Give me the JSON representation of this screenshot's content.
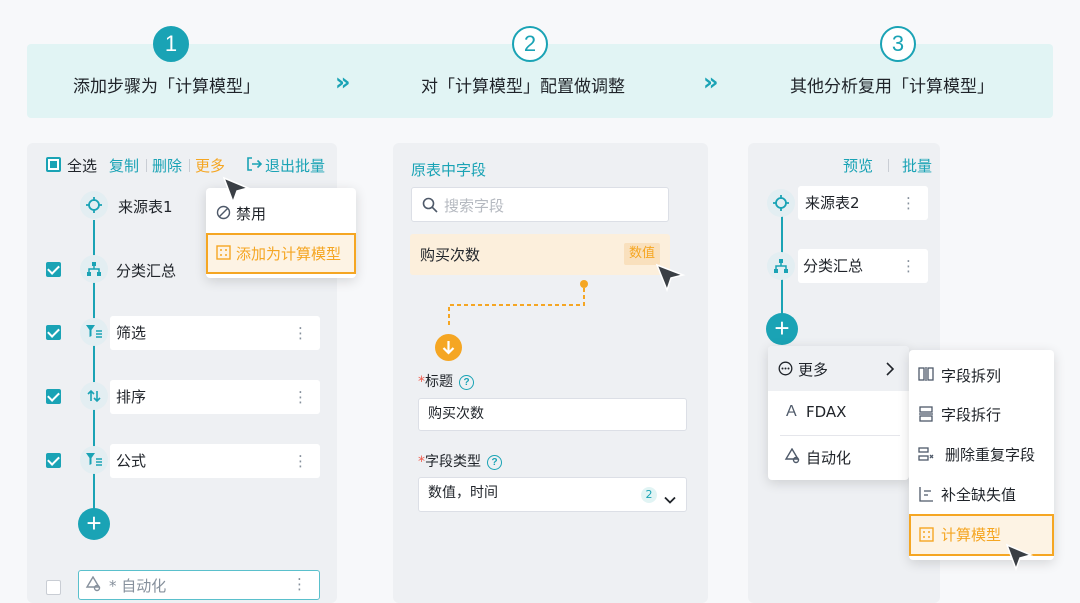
{
  "steps": [
    {
      "num": "1",
      "text": "添加步骤为「计算模型」"
    },
    {
      "num": "2",
      "text": "对「计算模型」配置做调整"
    },
    {
      "num": "3",
      "text": "其他分析复用「计算模型」"
    }
  ],
  "step_arrow": "»",
  "panel1": {
    "toolbar": {
      "select_all": "全选",
      "copy": "复制",
      "delete": "删除",
      "more": "更多",
      "exit_batch": "退出批量"
    },
    "nodes": [
      {
        "label": "来源表1",
        "icon": "target-icon"
      },
      {
        "label": "分类汇总",
        "icon": "hierarchy-icon"
      },
      {
        "label": "筛选",
        "icon": "filter-icon"
      },
      {
        "label": "排序",
        "icon": "sort-icon"
      },
      {
        "label": "公式",
        "icon": "formula-icon"
      },
      {
        "label": "* 自动化",
        "icon": "automation-icon"
      }
    ],
    "more_menu": {
      "disable": "禁用",
      "add_model": "添加为计算模型"
    },
    "add_glyph": "+",
    "dots": "⋮"
  },
  "panel2": {
    "title": "原表中字段",
    "search_placeholder": "搜索字段",
    "field": {
      "label": "购买次数",
      "badge": "数值"
    },
    "title_field": {
      "required": "*",
      "label": "标题",
      "value": "购买次数"
    },
    "type_field": {
      "required": "*",
      "label": "字段类型",
      "value": "数值，时间",
      "count": "2"
    }
  },
  "panel3": {
    "preview": "预览",
    "batch": "批量",
    "nodes": [
      {
        "label": "来源表2",
        "icon": "target-icon"
      },
      {
        "label": "分类汇总",
        "icon": "hierarchy-icon"
      }
    ],
    "menu": [
      {
        "label": "更多",
        "icon": "more-circle-icon"
      },
      {
        "label": "FDAX",
        "icon": "font-a-icon"
      },
      {
        "label": "自动化",
        "icon": "automation-icon"
      }
    ],
    "submenu": [
      {
        "label": "字段拆列",
        "icon": "split-column-icon"
      },
      {
        "label": "字段拆行",
        "icon": "split-row-icon"
      },
      {
        "label": "删除重复字段",
        "icon": "dedupe-icon"
      },
      {
        "label": "补全缺失值",
        "icon": "fill-missing-icon"
      },
      {
        "label": "计算模型",
        "icon": "calc-model-icon"
      }
    ]
  },
  "colors": {
    "accent": "#1aa3b5",
    "orange": "#f5a623",
    "banner_bg": "#e1f4f4"
  }
}
